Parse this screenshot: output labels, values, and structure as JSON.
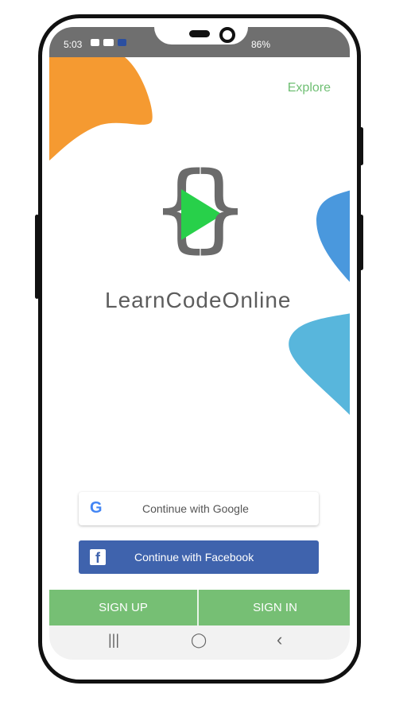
{
  "status": {
    "time": "5:03",
    "battery": "86%"
  },
  "top": {
    "explore_label": "Explore"
  },
  "brand": {
    "name": "LearnCodeOnline"
  },
  "auth": {
    "google_label": "Continue with Google",
    "facebook_label": "Continue with Facebook",
    "signup_label": "SIGN UP",
    "signin_label": "SIGN IN"
  },
  "icons": {
    "google_letter": "G",
    "facebook_letter": "f",
    "logo_left_brace": "{",
    "logo_right_brace": "}",
    "nav_recent": "|||",
    "nav_home": "◯",
    "nav_back": "‹"
  },
  "colors": {
    "primary_green": "#76bf74",
    "facebook_blue": "#3f63ad",
    "orange": "#f59a31",
    "blue": "#4aa3df"
  }
}
